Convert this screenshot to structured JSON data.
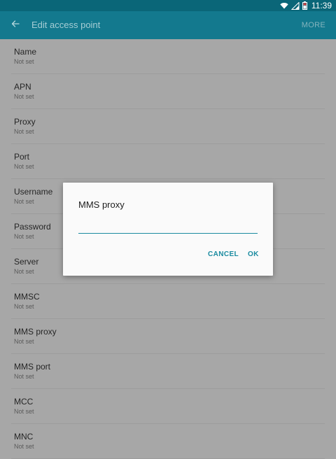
{
  "status_bar": {
    "time": "11:39",
    "icons": [
      "wifi-icon",
      "signal-icon",
      "battery-icon"
    ],
    "background": "#0a6678"
  },
  "app_bar": {
    "back_icon": "arrow-left-icon",
    "title": "Edit access point",
    "more_label": "MORE",
    "background": "#13798e"
  },
  "settings": [
    {
      "label": "Name",
      "value": "Not set"
    },
    {
      "label": "APN",
      "value": "Not set"
    },
    {
      "label": "Proxy",
      "value": "Not set"
    },
    {
      "label": "Port",
      "value": "Not set"
    },
    {
      "label": "Username",
      "value": "Not set"
    },
    {
      "label": "Password",
      "value": "Not set"
    },
    {
      "label": "Server",
      "value": "Not set"
    },
    {
      "label": "MMSC",
      "value": "Not set"
    },
    {
      "label": "MMS proxy",
      "value": "Not set"
    },
    {
      "label": "MMS port",
      "value": "Not set"
    },
    {
      "label": "MCC",
      "value": "Not set"
    },
    {
      "label": "MNC",
      "value": "Not set"
    }
  ],
  "dialog": {
    "title": "MMS proxy",
    "input_value": "",
    "cancel_label": "CANCEL",
    "ok_label": "OK",
    "accent": "#1a8ba0"
  }
}
